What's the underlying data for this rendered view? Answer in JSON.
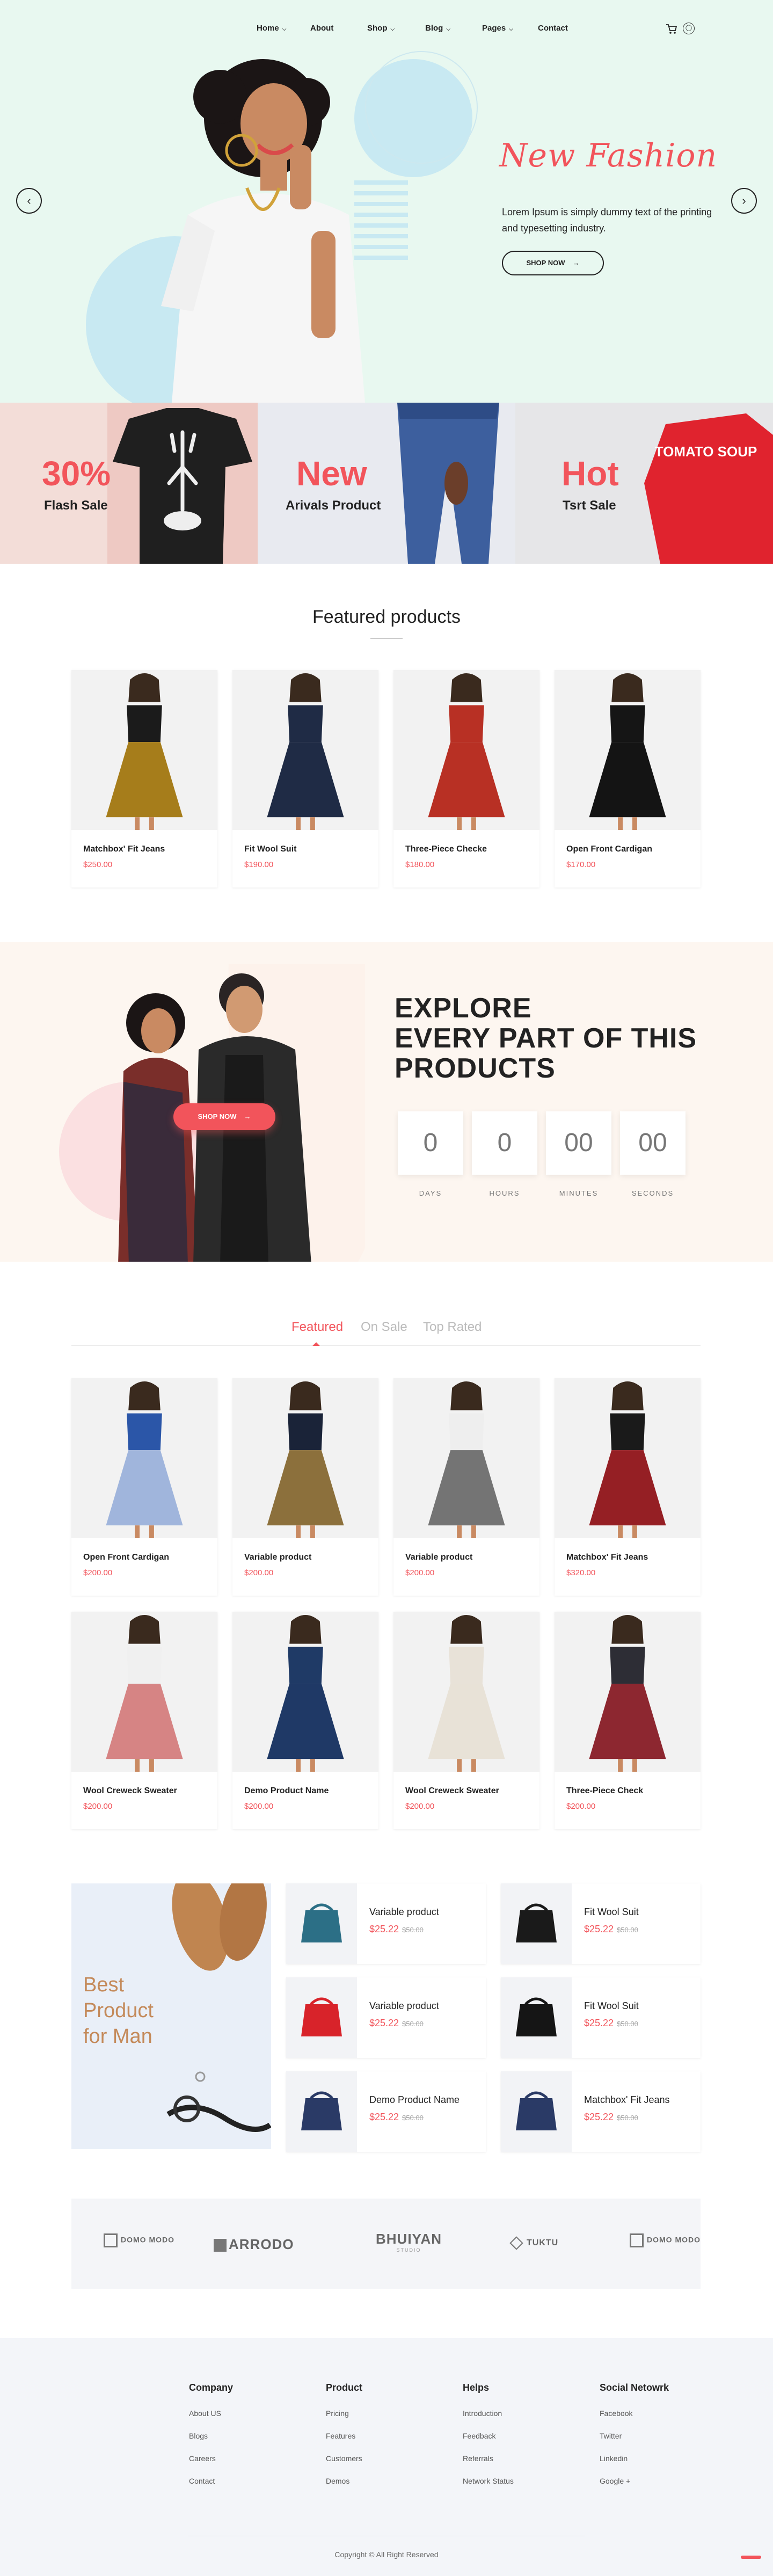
{
  "nav": {
    "items": [
      {
        "label": "Home",
        "caret": true
      },
      {
        "label": "About",
        "caret": false
      },
      {
        "label": "Shop",
        "caret": true
      },
      {
        "label": "Blog",
        "caret": true
      },
      {
        "label": "Pages",
        "caret": true
      },
      {
        "label": "Contact",
        "caret": false
      }
    ],
    "cart_icon": "cart-icon",
    "account_icon": "account-icon"
  },
  "hero": {
    "title": "New Fashion",
    "text": "Lorem Ipsum is simply dummy text of the printing and typesetting industry.",
    "button": "SHOP NOW",
    "prev": "‹",
    "next": "›"
  },
  "promos": [
    {
      "big": "30%",
      "small": "Flash Sale"
    },
    {
      "big": "New",
      "small": "Arivals Product"
    },
    {
      "big": "Hot",
      "small": "Tsrt Sale"
    }
  ],
  "promo_shirt_text": "TOMATO SOUP",
  "featured": {
    "title": "Featured products",
    "products": [
      {
        "name": "Matchbox' Fit Jeans",
        "price": "$250.00"
      },
      {
        "name": "Fit Wool Suit",
        "price": "$190.00"
      },
      {
        "name": "Three-Piece Checke",
        "price": "$180.00"
      },
      {
        "name": "Open Front Cardigan",
        "price": "$170.00"
      }
    ]
  },
  "explore": {
    "title_lines": [
      "EXPLORE",
      "EVERY PART OF THIS",
      "PRODUCTS"
    ],
    "button": "SHOP NOW",
    "countdown": [
      {
        "value": "0",
        "label": "DAYS"
      },
      {
        "value": "0",
        "label": "HOURS"
      },
      {
        "value": "00",
        "label": "MINUTES"
      },
      {
        "value": "00",
        "label": "SECONDS"
      }
    ]
  },
  "tabs": [
    {
      "label": "Featured",
      "active": true
    },
    {
      "label": "On Sale",
      "active": false
    },
    {
      "label": "Top Rated",
      "active": false
    }
  ],
  "tab_products": [
    {
      "name": "Open Front Cardigan",
      "price": "$200.00"
    },
    {
      "name": "Variable product",
      "price": "$200.00"
    },
    {
      "name": "Variable product",
      "price": "$200.00"
    },
    {
      "name": "Matchbox' Fit Jeans",
      "price": "$320.00"
    },
    {
      "name": "Wool Creweck Sweater",
      "price": "$200.00"
    },
    {
      "name": "Demo Product Name",
      "price": "$200.00"
    },
    {
      "name": "Wool Creweck Sweater",
      "price": "$200.00"
    },
    {
      "name": "Three-Piece Check",
      "price": "$200.00"
    }
  ],
  "best": {
    "title_lines": [
      "Best",
      "Product",
      "for Man"
    ],
    "items": [
      {
        "name": "Variable product",
        "price": "$25.22",
        "old": "$50.00"
      },
      {
        "name": "Fit Wool Suit",
        "price": "$25.22",
        "old": "$50.00"
      },
      {
        "name": "Variable product",
        "price": "$25.22",
        "old": "$50.00"
      },
      {
        "name": "Fit Wool Suit",
        "price": "$25.22",
        "old": "$50.00"
      },
      {
        "name": "Demo Product Name",
        "price": "$25.22",
        "old": "$50.00"
      },
      {
        "name": "Matchbox' Fit Jeans",
        "price": "$25.22",
        "old": "$50.00"
      }
    ]
  },
  "brands": [
    "DOMO MODO",
    "ARRODO",
    "BHUIYAN",
    "TUKTU",
    "DOMO MODO"
  ],
  "brand_sub": "STUDIO",
  "footer": {
    "columns": [
      {
        "title": "Company",
        "links": [
          "About US",
          "Blogs",
          "Careers",
          "Contact"
        ]
      },
      {
        "title": "Product",
        "links": [
          "Pricing",
          "Features",
          "Customers",
          "Demos"
        ]
      },
      {
        "title": "Helps",
        "links": [
          "Introduction",
          "Feedback",
          "Referrals",
          "Network Status"
        ]
      },
      {
        "title": "Social Netowrk",
        "links": [
          "Facebook",
          "Twitter",
          "Linkedin",
          "Google +"
        ]
      }
    ],
    "copyright": "Copyright © All Right Reserved"
  },
  "colors": {
    "accent": "#f2545b",
    "hero_bg": "#e8f8f0",
    "explore_bg": "#fdf6f0",
    "best_title": "#c48a5a"
  }
}
